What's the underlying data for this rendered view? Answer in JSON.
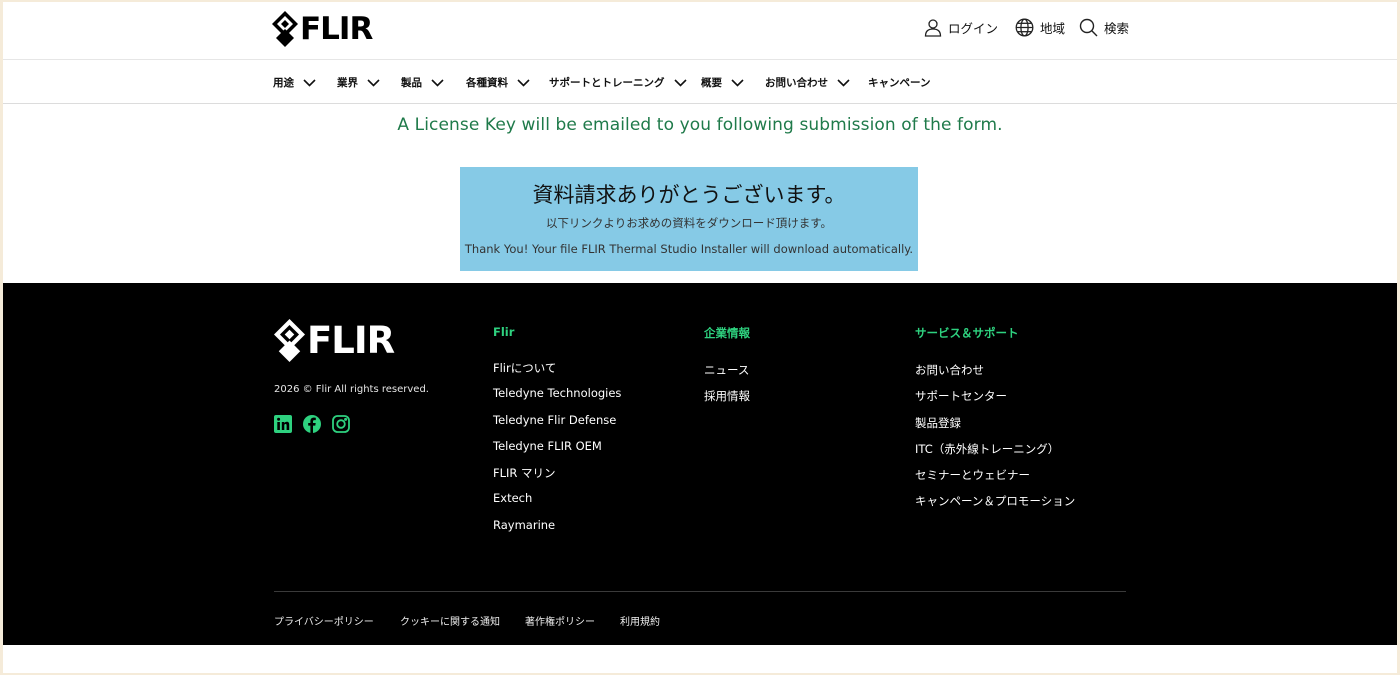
{
  "brand": {
    "name": "FLIR",
    "accent": "#2ed17f",
    "notice_color": "#1f7a4a",
    "box_color": "#86cae6"
  },
  "header": {
    "login": "ログイン",
    "region": "地域",
    "search": "検索",
    "nav": [
      "用途",
      "業界",
      "製品",
      "各種資料",
      "サポートとトレーニング",
      "概要",
      "お問い合わせ",
      "キャンペーン"
    ]
  },
  "main": {
    "notice": "A License Key will be emailed to you following submission of the form.",
    "thanks_title": "資料請求ありがとうございます。",
    "thanks_subtitle": "以下リンクよりお求めの資料をダウンロード頂けます。",
    "thanks_message": "Thank You! Your file FLIR Thermal Studio Installer will download automatically."
  },
  "footer": {
    "copyright": "2026 © Flir All rights reserved.",
    "social_icons": [
      "linkedin-icon",
      "facebook-icon",
      "instagram-icon"
    ],
    "columns": [
      {
        "heading": "Flir",
        "links": [
          "Flirについて",
          "Teledyne Technologies",
          "Teledyne Flir Defense",
          "Teledyne FLIR OEM",
          "FLIR マリン",
          "Extech",
          "Raymarine"
        ]
      },
      {
        "heading": "企業情報",
        "links": [
          "ニュース",
          "採用情報"
        ]
      },
      {
        "heading": "サービス＆サポート",
        "links": [
          "お問い合わせ",
          "サポートセンター",
          "製品登録",
          "ITC（赤外線トレーニング）",
          "セミナーとウェビナー",
          "キャンペーン＆プロモーション"
        ]
      }
    ],
    "legal": [
      "プライバシーポリシー",
      "クッキーに関する通知",
      "著作権ポリシー",
      "利用規約"
    ]
  }
}
